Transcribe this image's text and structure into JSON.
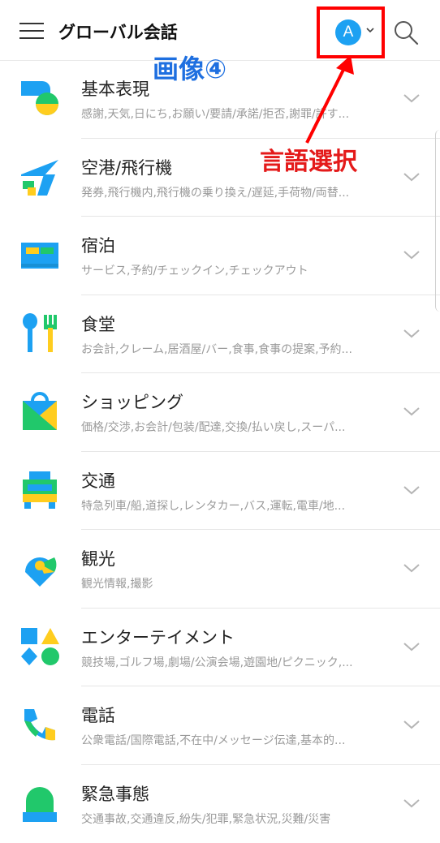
{
  "appbar": {
    "title": "グローバル会話",
    "language_avatar_letter": "A",
    "menu_icon": "hamburger-icon",
    "search_icon": "search-icon"
  },
  "annotations": {
    "image_label": "画像④",
    "language_select_label": "言語選択",
    "highlight_color": "#ff0000",
    "image_label_color": "#1e6fe0"
  },
  "categories": [
    {
      "title": "基本表現",
      "subtitle": "感謝,天気,日にち,お願い/要請/承諾/拒否,謝罪/許す...",
      "icon": "speech-bubbles-icon"
    },
    {
      "title": "空港/飛行機",
      "subtitle": "発券,飛行機内,飛行機の乗り換え/遅延,手荷物/両替...",
      "icon": "airplane-icon"
    },
    {
      "title": "宿泊",
      "subtitle": "サービス,予約/チェックイン,チェックアウト",
      "icon": "bed-icon"
    },
    {
      "title": "食堂",
      "subtitle": "お会計,クレーム,居酒屋/バー,食事,食事の提案,予約...",
      "icon": "spoon-fork-icon"
    },
    {
      "title": "ショッピング",
      "subtitle": "価格/交渉,お会計/包装/配達,交換/払い戻し,スーパ...",
      "icon": "shopping-bag-icon"
    },
    {
      "title": "交通",
      "subtitle": "特急列車/船,道探し,レンタカー,バス,運転,電車/地...",
      "icon": "car-icon"
    },
    {
      "title": "観光",
      "subtitle": "観光情報,撮影",
      "icon": "map-pin-icon"
    },
    {
      "title": "エンターテイメント",
      "subtitle": "競技場,ゴルフ場,劇場/公演会場,遊園地/ピクニック,...",
      "icon": "shapes-icon"
    },
    {
      "title": "電話",
      "subtitle": "公衆電話/国際電話,不在中/メッセージ伝達,基本的...",
      "icon": "phone-icon"
    },
    {
      "title": "緊急事態",
      "subtitle": "交通事故,交通違反,紛失/犯罪,緊急状況,災難/災害",
      "icon": "siren-icon"
    }
  ],
  "colors": {
    "blue": "#1da1f2",
    "yellow": "#ffcd1f",
    "green": "#21c86b"
  }
}
